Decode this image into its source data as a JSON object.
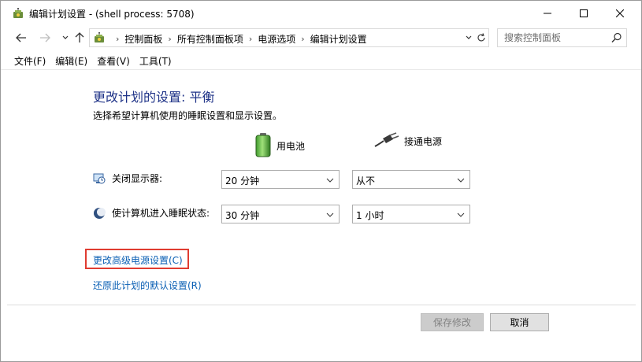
{
  "window": {
    "title": "编辑计划设置 - (shell process: 5708)"
  },
  "address": {
    "breadcrumbs": [
      "控制面板",
      "所有控制面板项",
      "电源选项",
      "编辑计划设置"
    ]
  },
  "search": {
    "placeholder": "搜索控制面板"
  },
  "menu": {
    "items": [
      "文件(F)",
      "编辑(E)",
      "查看(V)",
      "工具(T)"
    ]
  },
  "main": {
    "title": "更改计划的设置: 平衡",
    "description": "选择希望计算机使用的睡眠设置和显示设置。",
    "columns": {
      "battery": "用电池",
      "plugged": "接通电源"
    },
    "rows": [
      {
        "label": "关闭显示器:",
        "battery_value": "20 分钟",
        "plugged_value": "从不"
      },
      {
        "label": "使计算机进入睡眠状态:",
        "battery_value": "30 分钟",
        "plugged_value": "1 小时"
      }
    ],
    "links": {
      "advanced": "更改高级电源设置(C)",
      "restore": "还原此计划的默认设置(R)"
    }
  },
  "buttons": {
    "save": "保存修改",
    "cancel": "取消"
  },
  "colors": {
    "title_blue": "#1e3287",
    "link_blue": "#0a5fb4",
    "highlight_red": "#e03c31"
  }
}
